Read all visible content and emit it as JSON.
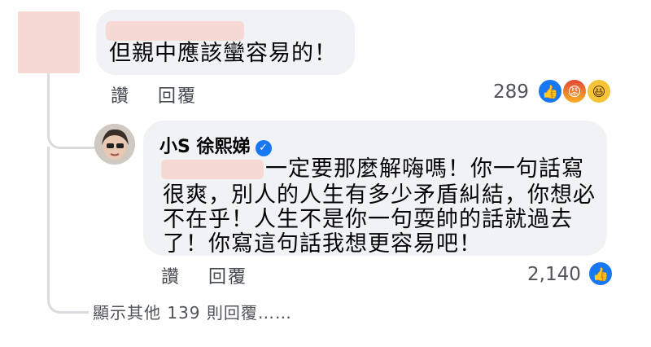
{
  "comment1": {
    "text": "但親中應該蠻容易的！",
    "actions": {
      "like_label": "讚",
      "reply_label": "回覆"
    },
    "reactions": {
      "count": "289",
      "icons": [
        "like-icon",
        "angry-icon",
        "haha-icon"
      ]
    }
  },
  "reply1": {
    "author": "小S 徐熙娣",
    "verified_icon": "verified-check-icon",
    "lines": [
      "一定要那麼解嗨嗎！你一句話寫",
      "很爽，別人的人生有多少矛盾糾結，你想必",
      "不在乎！人生不是你一句耍帥的話就過去",
      "了！你寫這句話我想更容易吧！"
    ],
    "actions": {
      "like_label": "讚",
      "reply_label": "回覆"
    },
    "reactions": {
      "count": "2,140",
      "icons": [
        "like-icon"
      ]
    }
  },
  "more_replies": {
    "label": "顯示其他 139 則回覆……"
  },
  "colors": {
    "bubble": "#f0f2f5",
    "like_blue": "#1877f2",
    "redaction": "#f6d9d3",
    "thread_line": "#d9dbde"
  }
}
